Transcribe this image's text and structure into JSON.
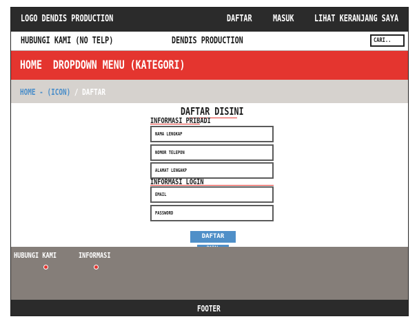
{
  "topbar": {
    "logo": "LOGO DENDIS PRODUCTION",
    "nav": [
      "DAFTAR",
      "MASUK",
      "LIHAT KERANJANG SAYA"
    ]
  },
  "subbar": {
    "contact": "HUBUNGI KAMI (NO TELP)",
    "brand": "DENDIS PRODUCTION",
    "search_placeholder": "CARI.."
  },
  "menu_bar": {
    "label": "HOME  DROPDOWN MENU (KATEGORI)"
  },
  "breadcrumb": {
    "link": "HOME - (ICON)",
    "separator": " / ",
    "current": "DAFTAR"
  },
  "form": {
    "title": "DAFTAR DISINI",
    "section_personal": "INFORMASI PRIBADI",
    "section_login": "INFORMASI LOGIN",
    "fields": {
      "full_name": "NAMA LENGKAP",
      "phone": "NOMOR TELEPON",
      "address": "ALAMAT LENGAKP",
      "email": "EMAIL",
      "password": "PASSWORD"
    },
    "submit_label": "DAFTAR",
    "cancel_label": "BATAL"
  },
  "footer_links": {
    "contact": "HUBUNGI KAMI",
    "info": "INFORMASI"
  },
  "footer": {
    "text": "FOOTER"
  },
  "colors": {
    "accent_red": "#e4352f",
    "dark": "#2b2b2b",
    "link_blue": "#4b8ec9",
    "button_blue": "#4f8fc8",
    "footer_gray": "#857e79",
    "crumb_bg": "#d6d2ce"
  }
}
